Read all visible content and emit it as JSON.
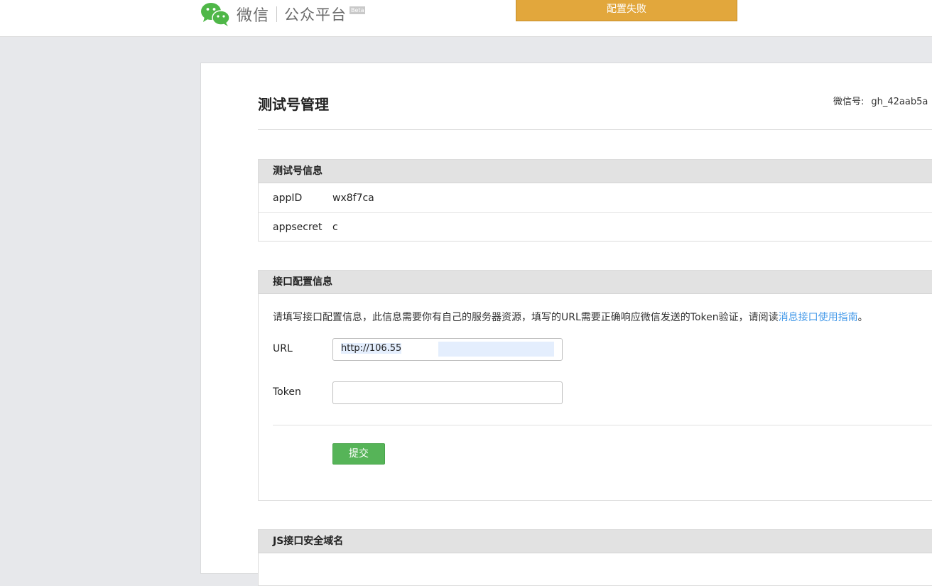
{
  "header": {
    "brand_wechat": "微信",
    "brand_platform": "公众平台",
    "beta": "Beta"
  },
  "toast": {
    "message": "配置失败",
    "color": "#e2a73c"
  },
  "page": {
    "title": "测试号管理",
    "account_label": "微信号:",
    "account_value": "gh_42aab5a"
  },
  "test_info": {
    "heading": "测试号信息",
    "rows": [
      {
        "label": "appID",
        "value": "wx8f7ca"
      },
      {
        "label": "appsecret",
        "value": "c"
      }
    ]
  },
  "interface_config": {
    "heading": "接口配置信息",
    "description": "请填写接口配置信息，此信息需要你有自己的服务器资源，填写的URL需要正确响应微信发送的Token验证，请阅读",
    "link_text": "消息接口使用指南",
    "description_end": "。",
    "url_label": "URL",
    "url_value": "http://106.55",
    "token_label": "Token",
    "token_value": "",
    "submit_label": "提交"
  },
  "js_domain": {
    "heading": "JS接口安全域名"
  },
  "colors": {
    "accent_green": "#56b458",
    "link_blue": "#459ae9",
    "warning_orange": "#e2a73c",
    "page_bg": "#e7e8eb"
  }
}
